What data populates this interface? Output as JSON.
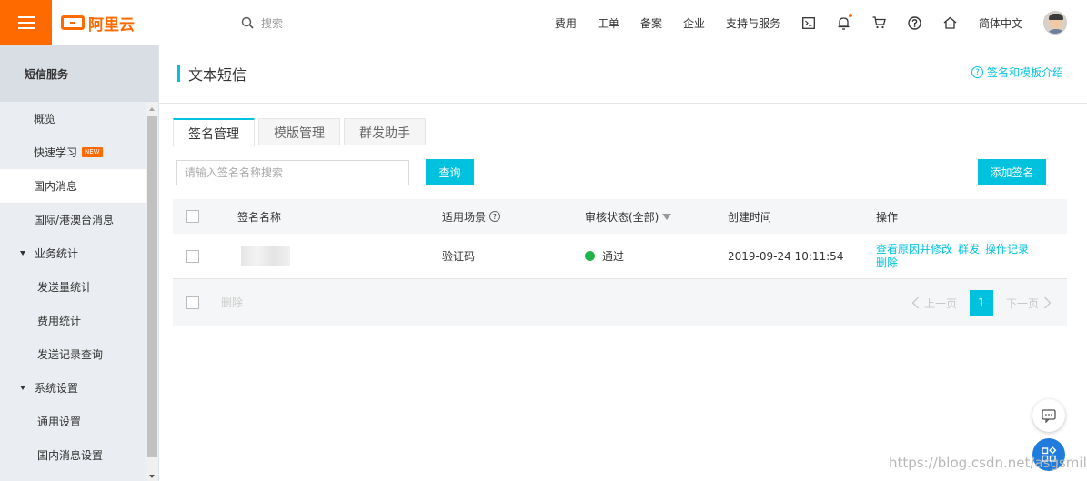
{
  "header": {
    "brand": "阿里云",
    "search_placeholder": "搜索",
    "nav_items": [
      "费用",
      "工单",
      "备案",
      "企业",
      "支持与服务"
    ],
    "language": "简体中文",
    "icons": [
      "terminal-icon",
      "bell-icon",
      "cart-icon",
      "help-icon",
      "home-icon"
    ]
  },
  "sidebar": {
    "title": "短信服务",
    "items": [
      {
        "label": "概览"
      },
      {
        "label": "快速学习",
        "badge": "NEW"
      },
      {
        "label": "国内消息"
      },
      {
        "label": "国际/港澳台消息"
      }
    ],
    "groups": [
      {
        "label": "业务统计",
        "children": [
          "发送量统计",
          "费用统计",
          "发送记录查询"
        ]
      },
      {
        "label": "系统设置",
        "children": [
          "通用设置",
          "国内消息设置"
        ]
      }
    ]
  },
  "page": {
    "title": "文本短信",
    "help_link": "签名和模板介绍",
    "tabs": [
      "签名管理",
      "模版管理",
      "群发助手"
    ]
  },
  "toolbar": {
    "search_placeholder": "请输入签名名称搜索",
    "query_button": "查询",
    "add_button": "添加签名"
  },
  "table": {
    "columns": [
      "签名名称",
      "适用场景",
      "审核状态(全部)",
      "创建时间",
      "操作"
    ],
    "rows": [
      {
        "scene": "验证码",
        "status": "通过",
        "created": "2019-09-24 10:11:54",
        "actions": [
          "查看原因并修改",
          "群发",
          "操作记录",
          "删除"
        ]
      }
    ],
    "footer_delete": "删除"
  },
  "pagination": {
    "prev": "上一页",
    "current": "1",
    "next": "下一页"
  },
  "watermark": "https://blog.csdn.net/asgsmile",
  "colors": {
    "brand_orange": "#ff6a00",
    "accent": "#00c1de",
    "success": "#1fb54c",
    "float_blue": "#1f7bdc"
  }
}
